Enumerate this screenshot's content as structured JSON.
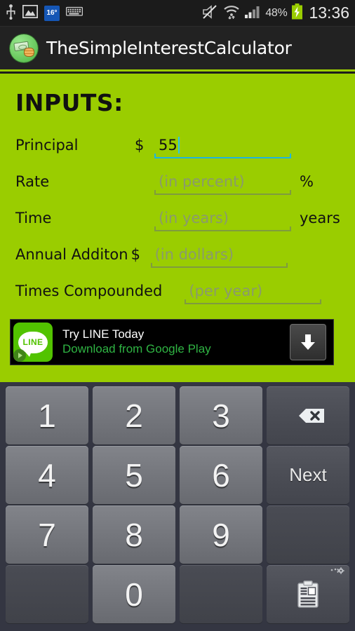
{
  "status_bar": {
    "left_icons": [
      {
        "name": "usb-icon",
        "label": "USB"
      },
      {
        "name": "image-icon",
        "label": "Image"
      },
      {
        "name": "temperature-badge",
        "label": "16°"
      },
      {
        "name": "keyboard-icon",
        "label": "Keyboard"
      }
    ],
    "right_icons": [
      {
        "name": "mute-icon",
        "label": "Muted"
      },
      {
        "name": "wifi-icon",
        "label": "Wi-Fi"
      },
      {
        "name": "signal-icon",
        "label": "Signal"
      }
    ],
    "temperature": "16°",
    "battery_percent": "48%",
    "clock": "13:36"
  },
  "title_bar": {
    "app_name": "TheSimpleInterestCalculator",
    "icon_name": "money-stack-icon"
  },
  "main": {
    "heading": "INPUTS:",
    "accent_color": "#9ACD00",
    "active_field_color": "#1eb6e0",
    "fields": [
      {
        "label": "Principal",
        "prefix": "$",
        "value": "55",
        "placeholder": "",
        "suffix": "",
        "active": true
      },
      {
        "label": "Rate",
        "prefix": "",
        "value": "",
        "placeholder": "(in percent)",
        "suffix": "%",
        "active": false
      },
      {
        "label": "Time",
        "prefix": "",
        "value": "",
        "placeholder": "(in years)",
        "suffix": "years",
        "active": false
      },
      {
        "label": "Annual Additon",
        "prefix": "$",
        "value": "",
        "placeholder": "(in dollars)",
        "suffix": "",
        "active": false
      },
      {
        "label": "Times Compounded",
        "prefix": "",
        "value": "",
        "placeholder": "(per year)",
        "suffix": "",
        "active": false
      }
    ]
  },
  "ad": {
    "logo_text": "LINE",
    "title": "Try LINE Today",
    "subtitle": "Download from Google Play",
    "download_icon": "download-arrow-icon"
  },
  "keyboard": {
    "rows": [
      [
        {
          "label": "1",
          "type": "num",
          "name": "key-1"
        },
        {
          "label": "2",
          "type": "num",
          "name": "key-2"
        },
        {
          "label": "3",
          "type": "num",
          "name": "key-3"
        },
        {
          "label": "",
          "type": "fn",
          "name": "key-backspace",
          "icon": "backspace-icon"
        }
      ],
      [
        {
          "label": "4",
          "type": "num",
          "name": "key-4"
        },
        {
          "label": "5",
          "type": "num",
          "name": "key-5"
        },
        {
          "label": "6",
          "type": "num",
          "name": "key-6"
        },
        {
          "label": "Next",
          "type": "fn",
          "name": "key-next"
        }
      ],
      [
        {
          "label": "7",
          "type": "num",
          "name": "key-7"
        },
        {
          "label": "8",
          "type": "num",
          "name": "key-8"
        },
        {
          "label": "9",
          "type": "num",
          "name": "key-9"
        },
        {
          "label": "",
          "type": "blank",
          "name": "key-blank-1"
        }
      ],
      [
        {
          "label": "",
          "type": "blank",
          "name": "key-blank-2"
        },
        {
          "label": "0",
          "type": "num",
          "name": "key-0"
        },
        {
          "label": "",
          "type": "blank",
          "name": "key-blank-3"
        },
        {
          "label": "",
          "type": "fn",
          "name": "key-clipboard",
          "icon": "clipboard-icon"
        }
      ]
    ]
  }
}
